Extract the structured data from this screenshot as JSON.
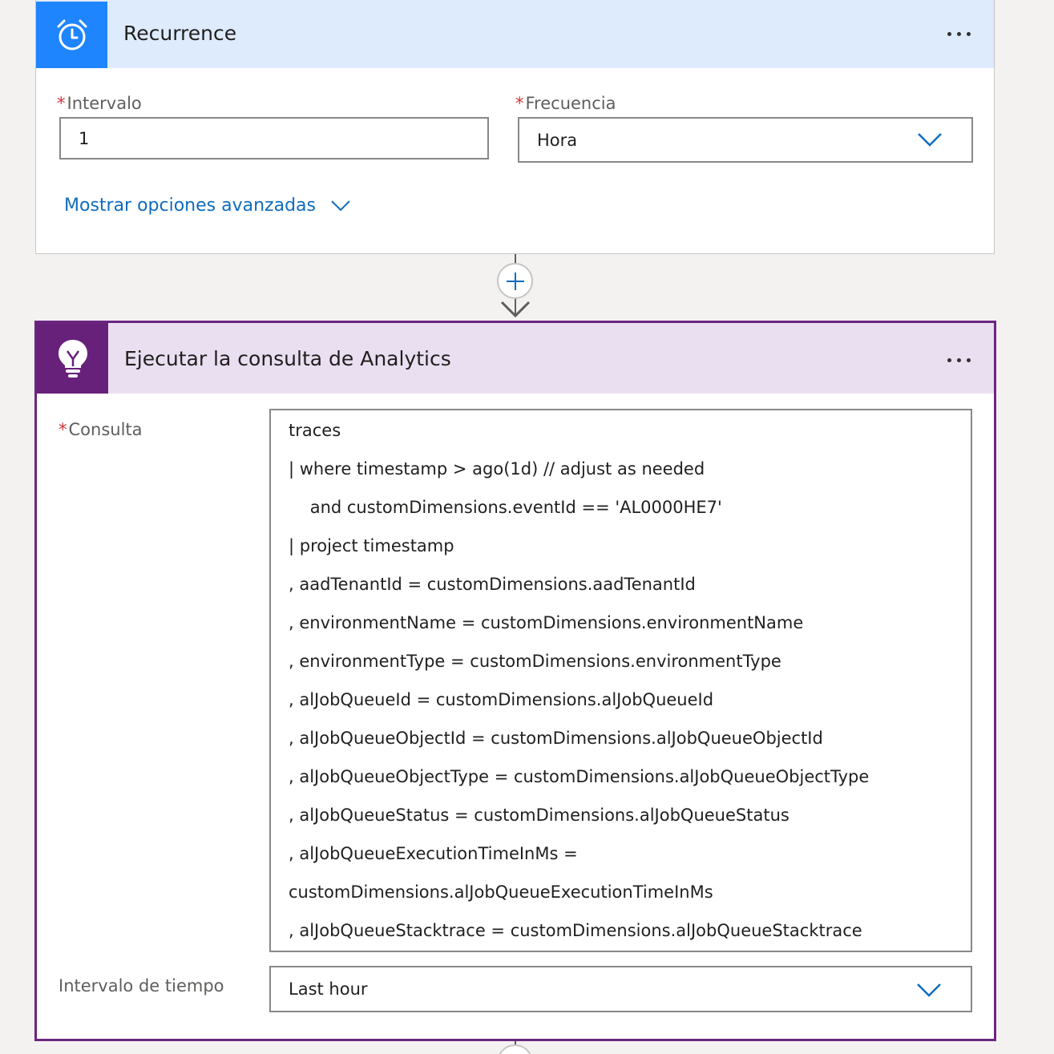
{
  "recurrence": {
    "title": "Recurrence",
    "interval_label": "Intervalo",
    "interval_value": "1",
    "frequency_label": "Frecuencia",
    "frequency_value": "Hora",
    "advanced_link": "Mostrar opciones avanzadas",
    "required_mark": "*",
    "icon": "alarm-clock-icon"
  },
  "connector": {
    "icon": "plus-icon"
  },
  "analytics": {
    "title": "Ejecutar la consulta de Analytics",
    "icon": "lightbulb-icon",
    "query_label": "Consulta",
    "required_mark": "*",
    "query_lines": [
      "traces",
      "| where timestamp > ago(1d) // adjust as needed",
      "    and customDimensions.eventId == 'AL0000HE7'",
      "| project timestamp",
      ", aadTenantId = customDimensions.aadTenantId",
      ", environmentName = customDimensions.environmentName",
      ", environmentType = customDimensions.environmentType",
      ", alJobQueueId = customDimensions.alJobQueueId",
      ", alJobQueueObjectId = customDimensions.alJobQueueObjectId",
      ", alJobQueueObjectType = customDimensions.alJobQueueObjectType",
      ", alJobQueueStatus = customDimensions.alJobQueueStatus",
      ", alJobQueueExecutionTimeInMs =",
      "customDimensions.alJobQueueExecutionTimeInMs",
      ", alJobQueueStacktrace = customDimensions.alJobQueueStacktrace"
    ],
    "timespan_label": "Intervalo de tiempo",
    "timespan_value": "Last hour"
  },
  "colors": {
    "recurrence_accent": "#1f85ff",
    "recurrence_header": "#deebfc",
    "analytics_accent": "#68217a",
    "analytics_header": "#eadff0",
    "link": "#0f6cbd",
    "required": "#d13438"
  }
}
